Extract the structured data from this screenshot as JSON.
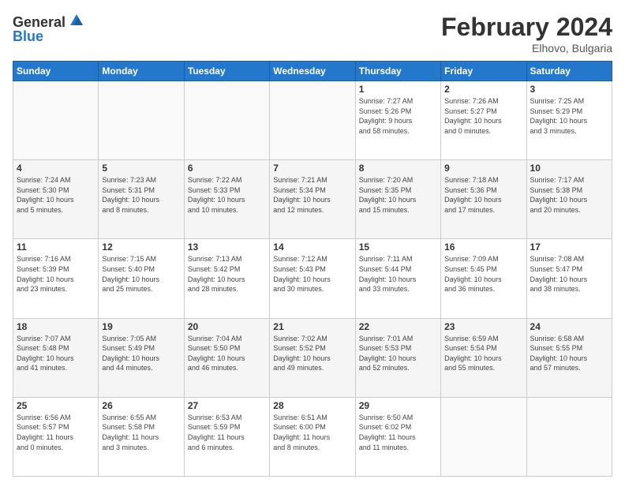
{
  "header": {
    "logo_general": "General",
    "logo_blue": "Blue",
    "month": "February 2024",
    "location": "Elhovo, Bulgaria"
  },
  "days_of_week": [
    "Sunday",
    "Monday",
    "Tuesday",
    "Wednesday",
    "Thursday",
    "Friday",
    "Saturday"
  ],
  "weeks": [
    {
      "days": [
        {
          "num": "",
          "info": ""
        },
        {
          "num": "",
          "info": ""
        },
        {
          "num": "",
          "info": ""
        },
        {
          "num": "",
          "info": ""
        },
        {
          "num": "1",
          "info": "Sunrise: 7:27 AM\nSunset: 5:26 PM\nDaylight: 9 hours\nand 58 minutes."
        },
        {
          "num": "2",
          "info": "Sunrise: 7:26 AM\nSunset: 5:27 PM\nDaylight: 10 hours\nand 0 minutes."
        },
        {
          "num": "3",
          "info": "Sunrise: 7:25 AM\nSunset: 5:29 PM\nDaylight: 10 hours\nand 3 minutes."
        }
      ]
    },
    {
      "days": [
        {
          "num": "4",
          "info": "Sunrise: 7:24 AM\nSunset: 5:30 PM\nDaylight: 10 hours\nand 5 minutes."
        },
        {
          "num": "5",
          "info": "Sunrise: 7:23 AM\nSunset: 5:31 PM\nDaylight: 10 hours\nand 8 minutes."
        },
        {
          "num": "6",
          "info": "Sunrise: 7:22 AM\nSunset: 5:33 PM\nDaylight: 10 hours\nand 10 minutes."
        },
        {
          "num": "7",
          "info": "Sunrise: 7:21 AM\nSunset: 5:34 PM\nDaylight: 10 hours\nand 12 minutes."
        },
        {
          "num": "8",
          "info": "Sunrise: 7:20 AM\nSunset: 5:35 PM\nDaylight: 10 hours\nand 15 minutes."
        },
        {
          "num": "9",
          "info": "Sunrise: 7:18 AM\nSunset: 5:36 PM\nDaylight: 10 hours\nand 17 minutes."
        },
        {
          "num": "10",
          "info": "Sunrise: 7:17 AM\nSunset: 5:38 PM\nDaylight: 10 hours\nand 20 minutes."
        }
      ]
    },
    {
      "days": [
        {
          "num": "11",
          "info": "Sunrise: 7:16 AM\nSunset: 5:39 PM\nDaylight: 10 hours\nand 23 minutes."
        },
        {
          "num": "12",
          "info": "Sunrise: 7:15 AM\nSunset: 5:40 PM\nDaylight: 10 hours\nand 25 minutes."
        },
        {
          "num": "13",
          "info": "Sunrise: 7:13 AM\nSunset: 5:42 PM\nDaylight: 10 hours\nand 28 minutes."
        },
        {
          "num": "14",
          "info": "Sunrise: 7:12 AM\nSunset: 5:43 PM\nDaylight: 10 hours\nand 30 minutes."
        },
        {
          "num": "15",
          "info": "Sunrise: 7:11 AM\nSunset: 5:44 PM\nDaylight: 10 hours\nand 33 minutes."
        },
        {
          "num": "16",
          "info": "Sunrise: 7:09 AM\nSunset: 5:45 PM\nDaylight: 10 hours\nand 36 minutes."
        },
        {
          "num": "17",
          "info": "Sunrise: 7:08 AM\nSunset: 5:47 PM\nDaylight: 10 hours\nand 38 minutes."
        }
      ]
    },
    {
      "days": [
        {
          "num": "18",
          "info": "Sunrise: 7:07 AM\nSunset: 5:48 PM\nDaylight: 10 hours\nand 41 minutes."
        },
        {
          "num": "19",
          "info": "Sunrise: 7:05 AM\nSunset: 5:49 PM\nDaylight: 10 hours\nand 44 minutes."
        },
        {
          "num": "20",
          "info": "Sunrise: 7:04 AM\nSunset: 5:50 PM\nDaylight: 10 hours\nand 46 minutes."
        },
        {
          "num": "21",
          "info": "Sunrise: 7:02 AM\nSunset: 5:52 PM\nDaylight: 10 hours\nand 49 minutes."
        },
        {
          "num": "22",
          "info": "Sunrise: 7:01 AM\nSunset: 5:53 PM\nDaylight: 10 hours\nand 52 minutes."
        },
        {
          "num": "23",
          "info": "Sunrise: 6:59 AM\nSunset: 5:54 PM\nDaylight: 10 hours\nand 55 minutes."
        },
        {
          "num": "24",
          "info": "Sunrise: 6:58 AM\nSunset: 5:55 PM\nDaylight: 10 hours\nand 57 minutes."
        }
      ]
    },
    {
      "days": [
        {
          "num": "25",
          "info": "Sunrise: 6:56 AM\nSunset: 5:57 PM\nDaylight: 11 hours\nand 0 minutes."
        },
        {
          "num": "26",
          "info": "Sunrise: 6:55 AM\nSunset: 5:58 PM\nDaylight: 11 hours\nand 3 minutes."
        },
        {
          "num": "27",
          "info": "Sunrise: 6:53 AM\nSunset: 5:59 PM\nDaylight: 11 hours\nand 6 minutes."
        },
        {
          "num": "28",
          "info": "Sunrise: 6:51 AM\nSunset: 6:00 PM\nDaylight: 11 hours\nand 8 minutes."
        },
        {
          "num": "29",
          "info": "Sunrise: 6:50 AM\nSunset: 6:02 PM\nDaylight: 11 hours\nand 11 minutes."
        },
        {
          "num": "",
          "info": ""
        },
        {
          "num": "",
          "info": ""
        }
      ]
    }
  ]
}
